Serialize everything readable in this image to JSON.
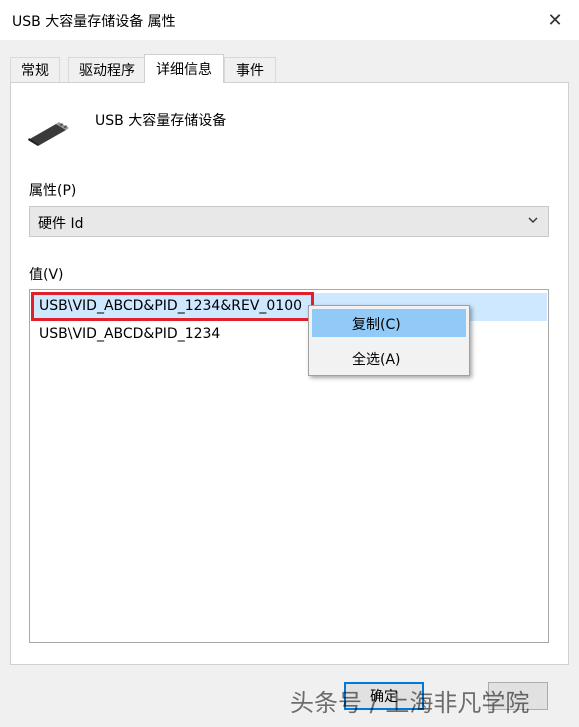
{
  "window": {
    "title": "USB 大容量存储设备 属性",
    "close_glyph": "✕"
  },
  "tabs": [
    {
      "label": "常规"
    },
    {
      "label": "驱动程序"
    },
    {
      "label": "详细信息"
    },
    {
      "label": "事件"
    }
  ],
  "active_tab": "详细信息",
  "device": {
    "name": "USB 大容量存储设备",
    "icon": "usb-plug-icon"
  },
  "property": {
    "label": "属性(P)",
    "selected": "硬件 Id"
  },
  "values": {
    "label": "值(V)",
    "items": [
      "USB\\VID_ABCD&PID_1234&REV_0100",
      "USB\\VID_ABCD&PID_1234"
    ]
  },
  "context_menu": {
    "items": [
      {
        "label": "复制(C)",
        "highlighted": true
      },
      {
        "label": "全选(A)",
        "highlighted": false
      }
    ]
  },
  "buttons": {
    "ok_label": "确定"
  },
  "watermark": "头条号 / 上海非凡学院",
  "colors": {
    "highlight_box": "#e0202a",
    "selected_row": "#cde8ff",
    "menu_highlight": "#91c9f7"
  }
}
